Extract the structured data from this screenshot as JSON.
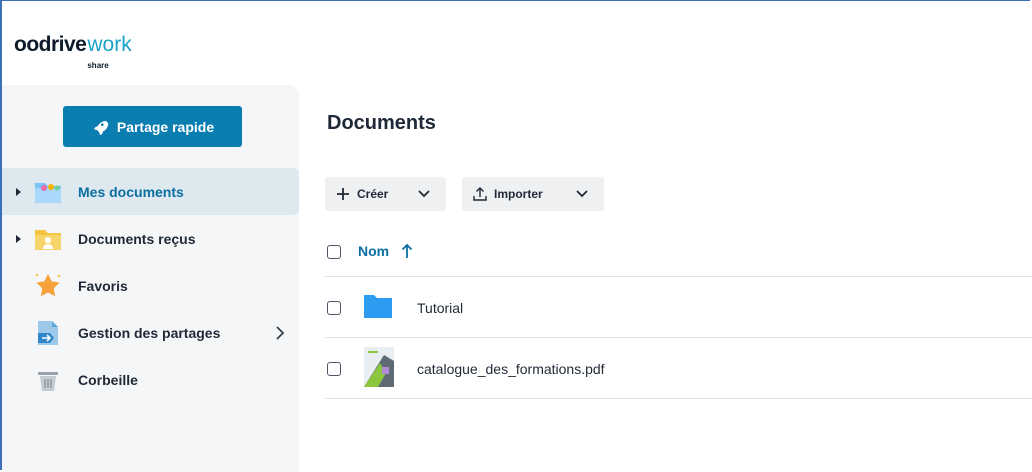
{
  "brand": {
    "name_main": "oodrive",
    "name_accent": "work",
    "name_sub": "share"
  },
  "sidebar": {
    "quick_share_label": "Partage rapide",
    "items": [
      {
        "label": "Mes documents",
        "icon": "folder-user-icon",
        "active": true,
        "expandable": true
      },
      {
        "label": "Documents reçus",
        "icon": "folder-received-icon",
        "active": false,
        "expandable": true
      },
      {
        "label": "Favoris",
        "icon": "star-icon",
        "active": false,
        "expandable": false
      },
      {
        "label": "Gestion des partages",
        "icon": "share-management-icon",
        "active": false,
        "expandable": false,
        "has_submenu": true
      },
      {
        "label": "Corbeille",
        "icon": "trash-icon",
        "active": false,
        "expandable": false
      }
    ]
  },
  "main": {
    "title": "Documents",
    "toolbar": {
      "create_label": "Créer",
      "import_label": "Importer"
    },
    "table": {
      "column_name": "Nom",
      "sort": "ascending",
      "rows": [
        {
          "name": "Tutorial",
          "type": "folder"
        },
        {
          "name": "catalogue_des_formations.pdf",
          "type": "pdf"
        }
      ]
    }
  },
  "colors": {
    "accent": "#0b7eb1",
    "accent_text": "#0b6fa3",
    "sidebar_bg": "#f5f6f8",
    "active_bg": "#dde8ef",
    "folder_blue": "#2d9cf0"
  }
}
